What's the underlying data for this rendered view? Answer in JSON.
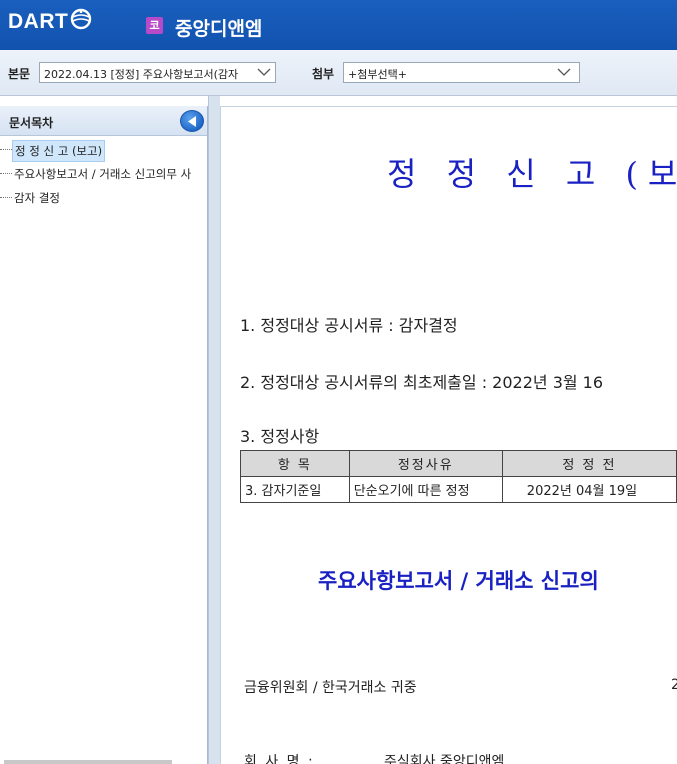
{
  "header": {
    "logo_text": "DART",
    "corp_badge": "코",
    "corp_name": "중앙디앤엠",
    "colors": {
      "header_bg": "#1657b8",
      "badge": "#b64ac8"
    }
  },
  "toolbar": {
    "main_label": "본문",
    "main_select": "2022.04.13 [정정] 주요사항보고서(감자",
    "attach_label": "첨부",
    "attach_select": "+첨부선택+"
  },
  "sidebar": {
    "title": "문서목차",
    "items": [
      {
        "label": "정 정 신 고 (보고)",
        "selected": true
      },
      {
        "label": "주요사항보고서 / 거래소 신고의무 사",
        "selected": false
      },
      {
        "label": "감자 결정",
        "selected": false
      }
    ]
  },
  "document": {
    "title": "정 정 신 고 (보고",
    "line1": "1. 정정대상 공시서류 : 감자결정",
    "line2": "2. 정정대상 공시서류의 최초제출일 : 2022년 3월 16",
    "line3": "3. 정정사항",
    "table": {
      "headers": [
        "항 목",
        "정정사유",
        "정 정 전"
      ],
      "rows": [
        [
          "3. 감자기준일",
          "단순오기에 따른 정정",
          "2022년 04월 19일"
        ]
      ]
    },
    "subtitle": "주요사항보고서 / 거래소 신고의",
    "addressee": "금융위원회 / 한국거래소 귀중",
    "addressee_right": "2",
    "company_label": "회  사  명 :",
    "company_value": "주식회사 중앙디앤엠",
    "title_color": "#1a21c2"
  }
}
